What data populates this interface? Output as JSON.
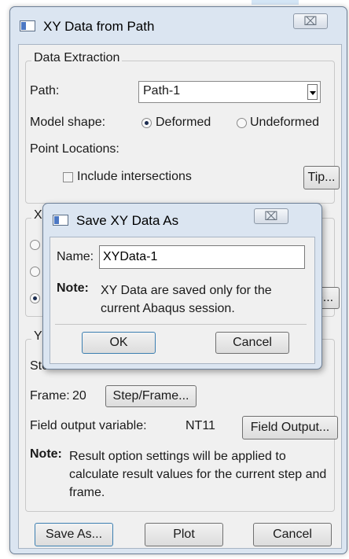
{
  "main_window": {
    "title": "XY Data from Path",
    "close_glyph": "⌧",
    "data_extraction": {
      "legend": "Data Extraction",
      "path_label": "Path:",
      "path_value": "Path-1",
      "model_shape_label": "Model shape:",
      "shape_options": [
        "Deformed",
        "Undeformed"
      ],
      "shape_selected": "Deformed",
      "point_locations_label": "Point Locations:",
      "include_intersections_label": "Include intersections",
      "include_intersections_checked": false,
      "tip_button": "Tip..."
    },
    "x_values_group": {
      "legend_visible": "X",
      "hidden_button_fragment": "p..."
    },
    "y_values_group": {
      "legend_visible": "Y",
      "step_label_fragment": "Ste",
      "frame_label": "Frame:",
      "frame_value": "20",
      "step_frame_button": "Step/Frame...",
      "field_output_label": "Field output variable:",
      "field_output_value": "NT11",
      "field_output_button": "Field Output...",
      "note_label": "Note:",
      "note_text": "Result option settings will be applied to calculate result values for the current step and frame."
    },
    "buttons": {
      "save_as": "Save As...",
      "plot": "Plot",
      "cancel": "Cancel"
    }
  },
  "save_dialog": {
    "title": "Save XY Data As",
    "close_glyph": "⌧",
    "name_label": "Name:",
    "name_value": "XYData-1",
    "note_label": "Note:",
    "note_text": "XY Data are saved only for the current Abaqus session.",
    "ok_button": "OK",
    "cancel_button": "Cancel"
  },
  "colors": {
    "title_bar": "#dbe5f1",
    "body": "#f0f0f0",
    "radio_selected": "#1b2c4f"
  }
}
